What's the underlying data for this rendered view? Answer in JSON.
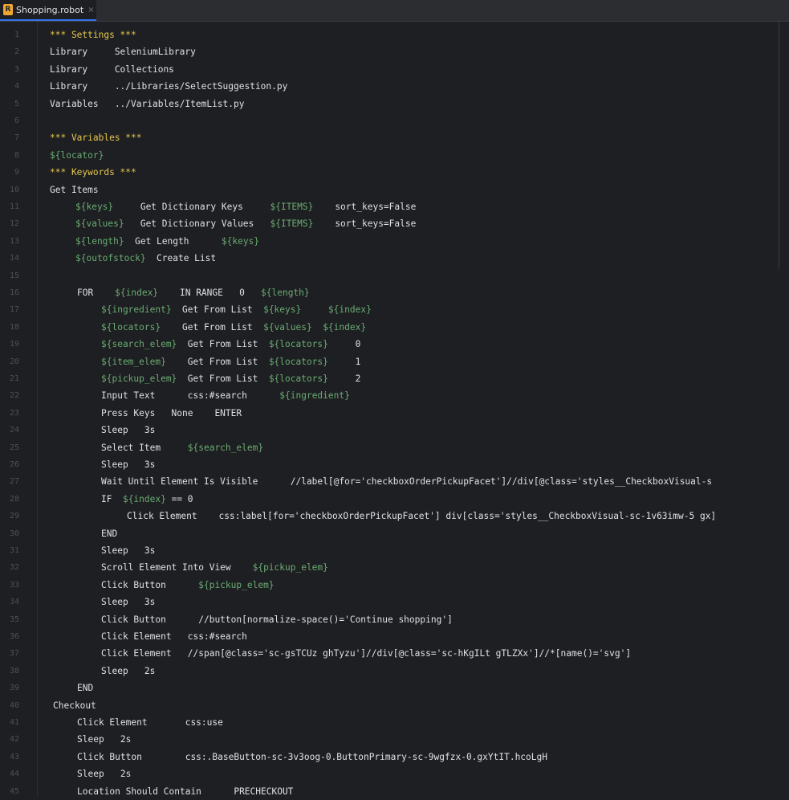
{
  "tab": {
    "label": "Shopping.robot",
    "close": "×",
    "icon": "robot-file-icon"
  },
  "colors": {
    "section": "#e6c84f",
    "variable": "#6aab73",
    "text": "#dfe1e5",
    "linenumber": "#4b5059",
    "background": "#1e1f22"
  },
  "lines": [
    {
      "n": "1",
      "indent": 0,
      "t": [
        [
          "*** Settings ***",
          "section"
        ]
      ]
    },
    {
      "n": "2",
      "indent": 0,
      "t": [
        [
          "Library     SeleniumLibrary",
          "plain"
        ]
      ]
    },
    {
      "n": "3",
      "indent": 0,
      "t": [
        [
          "Library     Collections",
          "plain"
        ]
      ]
    },
    {
      "n": "4",
      "indent": 0,
      "t": [
        [
          "Library     ../Libraries/SelectSuggestion.py",
          "plain"
        ]
      ]
    },
    {
      "n": "5",
      "indent": 0,
      "t": [
        [
          "Variables   ../Variables/ItemList.py",
          "plain"
        ]
      ]
    },
    {
      "n": "6",
      "indent": 0,
      "t": []
    },
    {
      "n": "7",
      "indent": 0,
      "t": [
        [
          "*** Variables ***",
          "section"
        ]
      ]
    },
    {
      "n": "8",
      "indent": 0,
      "t": [
        [
          "${locator}",
          "var"
        ]
      ]
    },
    {
      "n": "9",
      "indent": 0,
      "t": [
        [
          "*** Keywords ***",
          "section"
        ]
      ]
    },
    {
      "n": "10",
      "indent": 0,
      "t": [
        [
          "Get Items",
          "plain"
        ]
      ]
    },
    {
      "n": "11",
      "indent": 1,
      "t": [
        [
          "${keys}",
          "var"
        ],
        [
          "     Get Dictionary Keys     ",
          "kw"
        ],
        [
          "${ITEMS}",
          "var"
        ],
        [
          "    sort_keys=False",
          "plain"
        ]
      ]
    },
    {
      "n": "12",
      "indent": 1,
      "t": [
        [
          "${values}",
          "var"
        ],
        [
          "   Get Dictionary Values   ",
          "kw"
        ],
        [
          "${ITEMS}",
          "var"
        ],
        [
          "    sort_keys=False",
          "plain"
        ]
      ]
    },
    {
      "n": "13",
      "indent": 1,
      "t": [
        [
          "${length}",
          "var"
        ],
        [
          "  Get Length      ",
          "kw"
        ],
        [
          "${keys}",
          "var"
        ]
      ]
    },
    {
      "n": "14",
      "indent": 1,
      "t": [
        [
          "${outofstock}",
          "var"
        ],
        [
          "  Create List",
          "kw"
        ]
      ]
    },
    {
      "n": "15",
      "indent": 0,
      "t": []
    },
    {
      "n": "16",
      "indent": 2,
      "t": [
        [
          "FOR    ",
          "kw"
        ],
        [
          "${index}",
          "var"
        ],
        [
          "    IN RANGE   0   ",
          "kw"
        ],
        [
          "${length}",
          "var"
        ]
      ]
    },
    {
      "n": "17",
      "indent": 3,
      "t": [
        [
          "${ingredient}",
          "var"
        ],
        [
          "  Get From List  ",
          "kw"
        ],
        [
          "${keys}",
          "var"
        ],
        [
          "     ",
          "plain"
        ],
        [
          "${index}",
          "var"
        ]
      ]
    },
    {
      "n": "18",
      "indent": 3,
      "t": [
        [
          "${locators}",
          "var"
        ],
        [
          "    Get From List  ",
          "kw"
        ],
        [
          "${values}",
          "var"
        ],
        [
          "  ",
          "plain"
        ],
        [
          "${index}",
          "var"
        ]
      ]
    },
    {
      "n": "19",
      "indent": 3,
      "t": [
        [
          "${search_elem}",
          "var"
        ],
        [
          "  Get From List  ",
          "kw"
        ],
        [
          "${locators}",
          "var"
        ],
        [
          "     0",
          "num"
        ]
      ]
    },
    {
      "n": "20",
      "indent": 3,
      "t": [
        [
          "${item_elem}",
          "var"
        ],
        [
          "    Get From List  ",
          "kw"
        ],
        [
          "${locators}",
          "var"
        ],
        [
          "     1",
          "num"
        ]
      ]
    },
    {
      "n": "21",
      "indent": 3,
      "t": [
        [
          "${pickup_elem}",
          "var"
        ],
        [
          "  Get From List  ",
          "kw"
        ],
        [
          "${locators}",
          "var"
        ],
        [
          "     2",
          "num"
        ]
      ]
    },
    {
      "n": "22",
      "indent": 3,
      "t": [
        [
          "Input Text      css:#search      ",
          "kw"
        ],
        [
          "${ingredient}",
          "var"
        ]
      ]
    },
    {
      "n": "23",
      "indent": 3,
      "t": [
        [
          "Press Keys   None    ENTER",
          "kw"
        ]
      ]
    },
    {
      "n": "24",
      "indent": 3,
      "t": [
        [
          "Sleep   3s",
          "kw"
        ]
      ]
    },
    {
      "n": "25",
      "indent": 3,
      "t": [
        [
          "Select Item     ",
          "kw"
        ],
        [
          "${search_elem}",
          "var"
        ]
      ]
    },
    {
      "n": "26",
      "indent": 3,
      "t": [
        [
          "Sleep   3s",
          "kw"
        ]
      ]
    },
    {
      "n": "27",
      "indent": 3,
      "t": [
        [
          "Wait Until Element Is Visible      //label[@for='checkboxOrderPickupFacet']//div[@class='styles__CheckboxVisual-s",
          "kw"
        ]
      ]
    },
    {
      "n": "28",
      "indent": 3,
      "t": [
        [
          "IF  ",
          "kw"
        ],
        [
          "${index}",
          "var"
        ],
        [
          " == 0",
          "kw"
        ]
      ]
    },
    {
      "n": "29",
      "indent": 4,
      "t": [
        [
          "Click Element    css:label[for='checkboxOrderPickupFacet'] div[class='styles__CheckboxVisual-sc-1v63imw-5 gx]",
          "kw"
        ]
      ]
    },
    {
      "n": "30",
      "indent": 3,
      "t": [
        [
          "END",
          "kw"
        ]
      ]
    },
    {
      "n": "31",
      "indent": 3,
      "t": [
        [
          "Sleep   3s",
          "kw"
        ]
      ]
    },
    {
      "n": "32",
      "indent": 3,
      "t": [
        [
          "Scroll Element Into View    ",
          "kw"
        ],
        [
          "${pickup_elem}",
          "var"
        ]
      ]
    },
    {
      "n": "33",
      "indent": 3,
      "t": [
        [
          "Click Button      ",
          "kw"
        ],
        [
          "${pickup_elem}",
          "var"
        ]
      ]
    },
    {
      "n": "34",
      "indent": 3,
      "t": [
        [
          "Sleep   3s",
          "kw"
        ]
      ]
    },
    {
      "n": "35",
      "indent": 3,
      "t": [
        [
          "Click Button      //button[normalize-space()='Continue shopping']",
          "kw"
        ]
      ]
    },
    {
      "n": "36",
      "indent": 3,
      "t": [
        [
          "Click Element   css:#search",
          "kw"
        ]
      ]
    },
    {
      "n": "37",
      "indent": 3,
      "t": [
        [
          "Click Element   //span[@class='sc-gsTCUz ghTyzu']//div[@class='sc-hKgILt gTLZXx']//*[name()='svg']",
          "kw"
        ]
      ]
    },
    {
      "n": "38",
      "indent": 3,
      "t": [
        [
          "Sleep   2s",
          "kw"
        ]
      ]
    },
    {
      "n": "39",
      "indent": 2,
      "t": [
        [
          "END",
          "kw"
        ]
      ]
    },
    {
      "n": "40",
      "indent": 5,
      "t": [
        [
          "Checkout",
          "plain"
        ]
      ]
    },
    {
      "n": "41",
      "indent": 6,
      "t": [
        [
          "Click Element       css:use",
          "kw"
        ]
      ]
    },
    {
      "n": "42",
      "indent": 6,
      "t": [
        [
          "Sleep   2s",
          "kw"
        ]
      ]
    },
    {
      "n": "43",
      "indent": 6,
      "t": [
        [
          "Click Button        css:.BaseButton-sc-3v3oog-0.ButtonPrimary-sc-9wgfzx-0.gxYtIT.hcoLgH",
          "kw"
        ]
      ]
    },
    {
      "n": "44",
      "indent": 6,
      "t": [
        [
          "Sleep   2s",
          "kw"
        ]
      ]
    },
    {
      "n": "45",
      "indent": 6,
      "t": [
        [
          "Location Should Contain      PRECHECKOUT",
          "kw"
        ]
      ]
    }
  ]
}
